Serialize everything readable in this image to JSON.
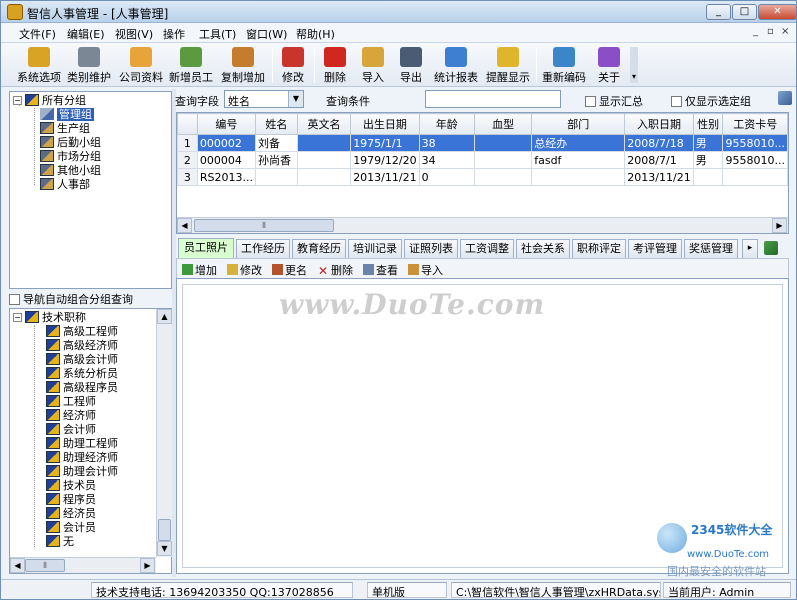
{
  "window": {
    "title": "智信人事管理 - [人事管理]",
    "minimize": "_",
    "maximize": "□",
    "close": "✕"
  },
  "menu": {
    "items": [
      "文件(F)",
      "编辑(E)",
      "视图(V)",
      "操作",
      "工具(T)",
      "窗口(W)",
      "帮助(H)"
    ],
    "mdi_controls": [
      "_",
      "▫",
      "×"
    ]
  },
  "toolbar": {
    "buttons": [
      {
        "label": "系统选项",
        "icon": "key-icon",
        "color": "#d9a325"
      },
      {
        "label": "类别维护",
        "icon": "tools-icon",
        "color": "#7b8794"
      },
      {
        "label": "公司资料",
        "icon": "company-icon",
        "color": "#e7a43b"
      },
      {
        "label": "新增员工",
        "icon": "add-user-icon",
        "color": "#5b9a3e"
      },
      {
        "label": "复制增加",
        "icon": "copy-add-icon",
        "color": "#c47d2f"
      },
      {
        "label": "修改",
        "icon": "pencil-icon",
        "color": "#c9342d"
      },
      {
        "label": "删除",
        "icon": "delete-icon",
        "color": "#d0281f"
      },
      {
        "label": "导入",
        "icon": "import-icon",
        "color": "#d8a53a"
      },
      {
        "label": "导出",
        "icon": "export-icon",
        "color": "#4a5c74"
      },
      {
        "label": "统计报表",
        "icon": "chart-icon",
        "color": "#3f7fd1"
      },
      {
        "label": "提醒显示",
        "icon": "alert-icon",
        "color": "#e0b52e"
      },
      {
        "label": "重新编码",
        "icon": "recode-icon",
        "color": "#3a86c9"
      },
      {
        "label": "关于",
        "icon": "help-icon",
        "color": "#8a4fc6"
      }
    ]
  },
  "org_tree": {
    "root": "所有分组",
    "items": [
      "管理组",
      "生产组",
      "后勤小组",
      "市场分组",
      "其他小组",
      "人事部"
    ],
    "selected": "管理组"
  },
  "nav_checkbox_label": "导航自动组合分组查询",
  "title_tree": {
    "root": "技术职称",
    "items": [
      "高级工程师",
      "高级经济师",
      "高级会计师",
      "系统分析员",
      "高级程序员",
      "工程师",
      "经济师",
      "会计师",
      "助理工程师",
      "助理经济师",
      "助理会计师",
      "技术员",
      "程序员",
      "经济员",
      "会计员",
      "无"
    ]
  },
  "query": {
    "field_label": "查询字段",
    "field_value": "姓名",
    "condition_label": "查询条件",
    "condition_value": "",
    "show_summary": "显示汇总",
    "only_selected": "仅显示选定组"
  },
  "grid": {
    "columns": [
      "",
      "编号",
      "姓名",
      "英文名",
      "出生日期",
      "年龄",
      "血型",
      "部门",
      "入职日期",
      "性别",
      "工资卡号"
    ],
    "rows": [
      [
        "1",
        "000002",
        "刘备",
        "",
        "1975/1/1",
        "38",
        "",
        "总经办",
        "2008/7/18",
        "男",
        "9558010..."
      ],
      [
        "2",
        "000004",
        "孙尚香",
        "",
        "1979/12/20",
        "34",
        "",
        "fasdf",
        "2008/7/1",
        "男",
        "9558010..."
      ],
      [
        "3",
        "RS2013...",
        "",
        "",
        "2013/11/21",
        "0",
        "",
        "",
        "2013/11/21",
        "",
        ""
      ]
    ]
  },
  "tabs": [
    "员工照片",
    "工作经历",
    "教育经历",
    "培训记录",
    "证照列表",
    "工资调整",
    "社会关系",
    "职称评定",
    "考评管理",
    "奖惩管理"
  ],
  "active_tab": "员工照片",
  "subtoolbar": [
    "增加",
    "修改",
    "更名",
    "删除",
    "查看",
    "导入"
  ],
  "watermark": {
    "main": "www.DuoTe.com",
    "brand": "2345软件大全",
    "url": "www.DuoTe.com",
    "slogan": "国内最安全的软件站"
  },
  "status": {
    "support": "技术支持电话: 13694203350 QQ:137028856",
    "edition": "单机版",
    "path": "C:\\智信软件\\智信人事管理\\zxHRData.sys",
    "user": "当前用户: Admin"
  },
  "colors": {
    "selection": "#3a74d6",
    "active_tab": "#d9ffd1",
    "tree_selection": "#2d5fb8"
  }
}
